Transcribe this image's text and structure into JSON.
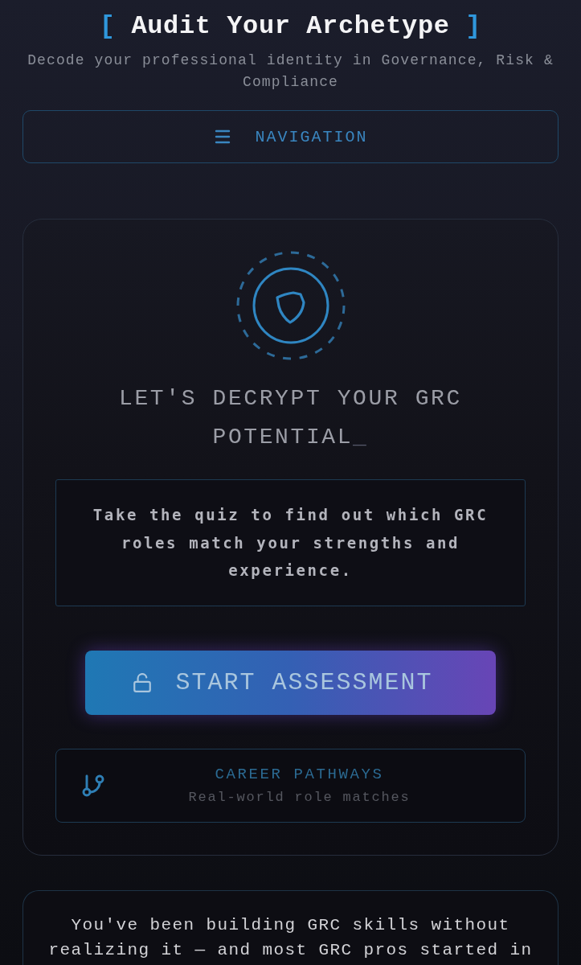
{
  "header": {
    "bracket_open": "[",
    "title": "Audit Your Archetype",
    "bracket_close": "]",
    "subtitle": "Decode your professional identity in Governance, Risk & Compliance"
  },
  "navigation": {
    "label": "NAVIGATION"
  },
  "hero": {
    "heading": "LET'S DECRYPT YOUR GRC POTENTIAL",
    "cursor": "_",
    "intro": "Take the quiz to find out which GRC roles match your strengths and experience.",
    "start_button": {
      "label": "START ASSESSMENT"
    },
    "feature": {
      "title": "CAREER PATHWAYS",
      "subtitle": "Real-world role matches"
    }
  },
  "info_card": {
    "text": "You've been building GRC skills without realizing it — and most GRC pros started in"
  }
}
